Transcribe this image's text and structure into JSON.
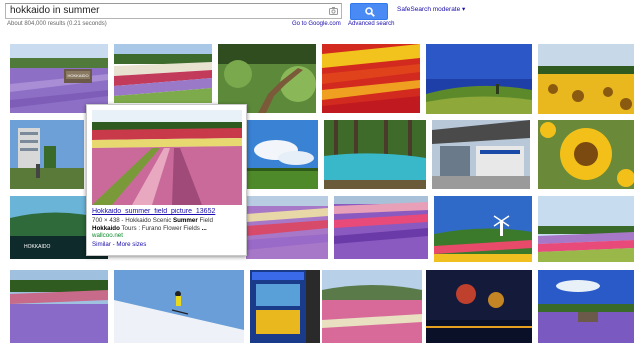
{
  "search": {
    "query": "hokkaido in summer",
    "results_count": "About 804,000 results (0.21 seconds)"
  },
  "header": {
    "safesearch": "SafeSearch moderate ▾",
    "goto_google": "Go to Google.com",
    "advanced_search": "Advanced search"
  },
  "popup": {
    "title": "Hokkaido_summer_field_picture_13652",
    "line1_prefix": "700 × 438 - Hokkaido Scenic ",
    "line1_bold": "Summer",
    "line1_suffix": " Field",
    "line2_bold1": "Hokkaido",
    "line2_mid": " Tours : Furano Flower Fields ",
    "line2_bold2": "...",
    "url": "wallcoo.net",
    "similar": "Similar",
    "sep": " - ",
    "more_sizes": "More sizes"
  },
  "thumbnails": {
    "hokkaido_sign": "HOKKAIDO",
    "hokkaido_logo": "HOKKAIDO"
  },
  "colors": {
    "accent": "#4a8af4",
    "link": "#1a0dab",
    "url_green": "#0a8a2a"
  }
}
